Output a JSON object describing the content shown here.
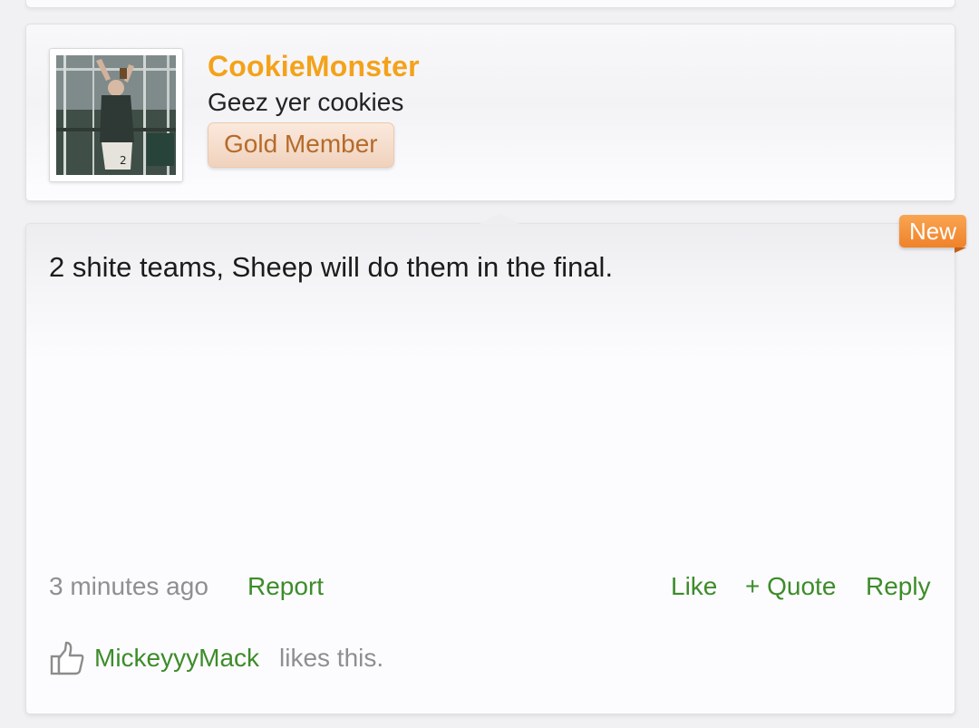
{
  "author": {
    "username": "CookieMonster",
    "user_title": "Geez yer cookies",
    "member_badge": "Gold Member",
    "avatar": "user-avatar-photo"
  },
  "post": {
    "new_badge": "New",
    "message": "2 shite teams, Sheep will do them in the final.",
    "timestamp": "3 minutes ago",
    "report_label": "Report",
    "like_label": "Like",
    "quote_label": "+ Quote",
    "reply_label": "Reply"
  },
  "likes": {
    "icon": "thumbs-up-icon",
    "liker": "MickeyyyMack",
    "suffix": "likes this."
  },
  "colors": {
    "username": "#f4a21a",
    "link": "#3d8c2a",
    "badge_new": "#f0822a",
    "badge_member_text": "#b56b2a"
  }
}
